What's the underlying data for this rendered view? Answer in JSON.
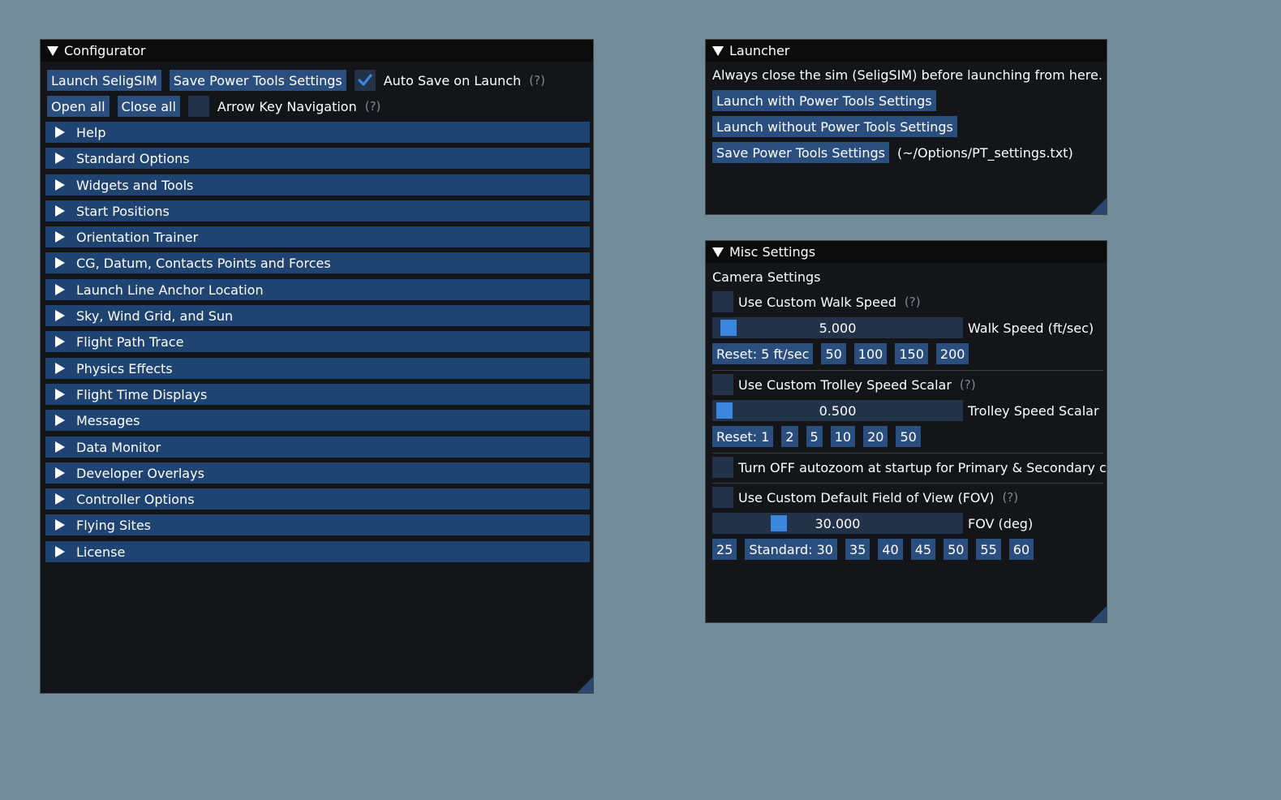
{
  "configurator": {
    "title": "Configurator",
    "launch_button": "Launch SeligSIM",
    "save_button": "Save Power Tools Settings",
    "auto_save_label": "Auto Save on Launch",
    "auto_save_checked": true,
    "help_marker": "(?)",
    "open_all_button": "Open all",
    "close_all_button": "Close all",
    "arrow_key_label": "Arrow Key Navigation",
    "arrow_key_checked": false,
    "sections": [
      "Help",
      "Standard Options",
      "Widgets and Tools",
      "Start Positions",
      "Orientation Trainer",
      "CG, Datum, Contacts Points and Forces",
      "Launch Line Anchor Location",
      "Sky, Wind Grid, and Sun",
      "Flight Path Trace",
      "Physics Effects",
      "Flight Time Displays",
      "Messages",
      "Data Monitor",
      "Developer Overlays",
      "Controller Options",
      "Flying Sites",
      "License"
    ]
  },
  "launcher": {
    "title": "Launcher",
    "notice": "Always close the sim (SeligSIM) before launching from here.",
    "launch_with_button": "Launch with Power Tools Settings",
    "launch_without_button": "Launch without Power Tools Settings",
    "save_button": "Save Power Tools Settings",
    "save_path": "(~/Options/PT_settings.txt)"
  },
  "misc": {
    "title": "Misc Settings",
    "camera_heading": "Camera Settings",
    "help_marker": "(?)",
    "walk": {
      "checkbox_label": "Use Custom Walk Speed",
      "checked": false,
      "value": "5.000",
      "level": 0.0,
      "slider_label": "Walk Speed (ft/sec)",
      "reset_button": "Reset: 5 ft/sec",
      "presets": [
        "50",
        "100",
        "150",
        "200"
      ]
    },
    "trolley": {
      "checkbox_label": "Use Custom Trolley Speed Scalar",
      "checked": false,
      "value": "0.500",
      "level": 0.0,
      "slider_label": "Trolley Speed Scalar",
      "reset_button": "Reset: 1",
      "presets": [
        "2",
        "5",
        "10",
        "20",
        "50"
      ]
    },
    "autozoom_label": "Turn OFF autozoom at startup for Primary & Secondary car",
    "autozoom_checked": false,
    "fov": {
      "checkbox_label": "Use Custom Default Field of View (FOV)",
      "checked": false,
      "value": "30.000",
      "level": 0.25,
      "slider_label": "FOV (deg)",
      "presets_before": [
        "25"
      ],
      "standard_button": "Standard: 30",
      "presets": [
        "35",
        "40",
        "45",
        "50",
        "55",
        "60"
      ]
    }
  },
  "colors": {
    "background": "#738c99",
    "window": "#141519",
    "header": "#1f4471",
    "button": "#2a4f7e",
    "accent": "#3d86e0"
  }
}
